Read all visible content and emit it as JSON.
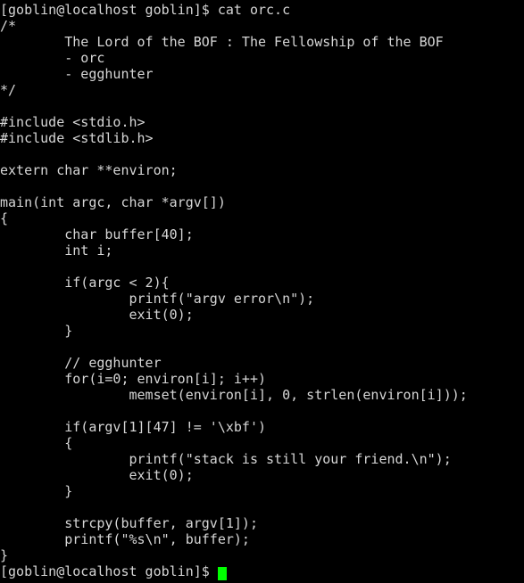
{
  "terminal": {
    "background_color": "#000000",
    "text_color": "#d6d6d6",
    "cursor_color": "#00ff00",
    "prompt": "[goblin@localhost goblin]$ ",
    "command": "cat orc.c",
    "command_line": "[goblin@localhost goblin]$ cat orc.c",
    "final_prompt": "[goblin@localhost goblin]$ ",
    "cursor_glyph": "block-cursor"
  },
  "file": {
    "name": "orc.c",
    "lines": [
      "/*",
      "        The Lord of the BOF : The Fellowship of the BOF",
      "        - orc",
      "        - egghunter",
      "*/",
      "",
      "#include <stdio.h>",
      "#include <stdlib.h>",
      "",
      "extern char **environ;",
      "",
      "main(int argc, char *argv[])",
      "{",
      "        char buffer[40];",
      "        int i;",
      "",
      "        if(argc < 2){",
      "                printf(\"argv error\\n\");",
      "                exit(0);",
      "        }",
      "",
      "        // egghunter",
      "        for(i=0; environ[i]; i++)",
      "                memset(environ[i], 0, strlen(environ[i]));",
      "",
      "        if(argv[1][47] != '\\xbf')",
      "        {",
      "                printf(\"stack is still your friend.\\n\");",
      "                exit(0);",
      "        }",
      "",
      "        strcpy(buffer, argv[1]);",
      "        printf(\"%s\\n\", buffer);",
      "}"
    ]
  }
}
